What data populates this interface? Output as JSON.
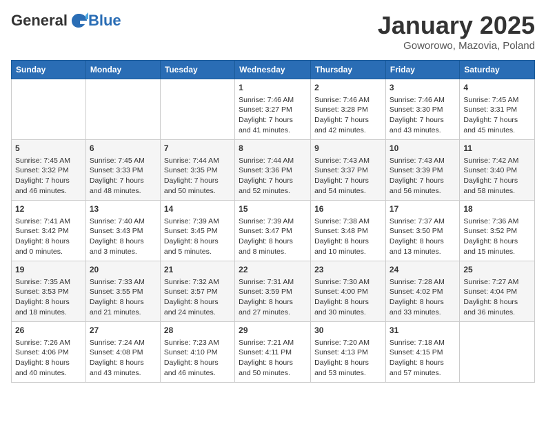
{
  "logo": {
    "general": "General",
    "blue": "Blue"
  },
  "title": "January 2025",
  "subtitle": "Goworowo, Mazovia, Poland",
  "days_of_week": [
    "Sunday",
    "Monday",
    "Tuesday",
    "Wednesday",
    "Thursday",
    "Friday",
    "Saturday"
  ],
  "weeks": [
    [
      {
        "day": "",
        "sunrise": "",
        "sunset": "",
        "daylight": ""
      },
      {
        "day": "",
        "sunrise": "",
        "sunset": "",
        "daylight": ""
      },
      {
        "day": "",
        "sunrise": "",
        "sunset": "",
        "daylight": ""
      },
      {
        "day": "1",
        "sunrise": "Sunrise: 7:46 AM",
        "sunset": "Sunset: 3:27 PM",
        "daylight": "Daylight: 7 hours and 41 minutes."
      },
      {
        "day": "2",
        "sunrise": "Sunrise: 7:46 AM",
        "sunset": "Sunset: 3:28 PM",
        "daylight": "Daylight: 7 hours and 42 minutes."
      },
      {
        "day": "3",
        "sunrise": "Sunrise: 7:46 AM",
        "sunset": "Sunset: 3:30 PM",
        "daylight": "Daylight: 7 hours and 43 minutes."
      },
      {
        "day": "4",
        "sunrise": "Sunrise: 7:45 AM",
        "sunset": "Sunset: 3:31 PM",
        "daylight": "Daylight: 7 hours and 45 minutes."
      }
    ],
    [
      {
        "day": "5",
        "sunrise": "Sunrise: 7:45 AM",
        "sunset": "Sunset: 3:32 PM",
        "daylight": "Daylight: 7 hours and 46 minutes."
      },
      {
        "day": "6",
        "sunrise": "Sunrise: 7:45 AM",
        "sunset": "Sunset: 3:33 PM",
        "daylight": "Daylight: 7 hours and 48 minutes."
      },
      {
        "day": "7",
        "sunrise": "Sunrise: 7:44 AM",
        "sunset": "Sunset: 3:35 PM",
        "daylight": "Daylight: 7 hours and 50 minutes."
      },
      {
        "day": "8",
        "sunrise": "Sunrise: 7:44 AM",
        "sunset": "Sunset: 3:36 PM",
        "daylight": "Daylight: 7 hours and 52 minutes."
      },
      {
        "day": "9",
        "sunrise": "Sunrise: 7:43 AM",
        "sunset": "Sunset: 3:37 PM",
        "daylight": "Daylight: 7 hours and 54 minutes."
      },
      {
        "day": "10",
        "sunrise": "Sunrise: 7:43 AM",
        "sunset": "Sunset: 3:39 PM",
        "daylight": "Daylight: 7 hours and 56 minutes."
      },
      {
        "day": "11",
        "sunrise": "Sunrise: 7:42 AM",
        "sunset": "Sunset: 3:40 PM",
        "daylight": "Daylight: 7 hours and 58 minutes."
      }
    ],
    [
      {
        "day": "12",
        "sunrise": "Sunrise: 7:41 AM",
        "sunset": "Sunset: 3:42 PM",
        "daylight": "Daylight: 8 hours and 0 minutes."
      },
      {
        "day": "13",
        "sunrise": "Sunrise: 7:40 AM",
        "sunset": "Sunset: 3:43 PM",
        "daylight": "Daylight: 8 hours and 3 minutes."
      },
      {
        "day": "14",
        "sunrise": "Sunrise: 7:39 AM",
        "sunset": "Sunset: 3:45 PM",
        "daylight": "Daylight: 8 hours and 5 minutes."
      },
      {
        "day": "15",
        "sunrise": "Sunrise: 7:39 AM",
        "sunset": "Sunset: 3:47 PM",
        "daylight": "Daylight: 8 hours and 8 minutes."
      },
      {
        "day": "16",
        "sunrise": "Sunrise: 7:38 AM",
        "sunset": "Sunset: 3:48 PM",
        "daylight": "Daylight: 8 hours and 10 minutes."
      },
      {
        "day": "17",
        "sunrise": "Sunrise: 7:37 AM",
        "sunset": "Sunset: 3:50 PM",
        "daylight": "Daylight: 8 hours and 13 minutes."
      },
      {
        "day": "18",
        "sunrise": "Sunrise: 7:36 AM",
        "sunset": "Sunset: 3:52 PM",
        "daylight": "Daylight: 8 hours and 15 minutes."
      }
    ],
    [
      {
        "day": "19",
        "sunrise": "Sunrise: 7:35 AM",
        "sunset": "Sunset: 3:53 PM",
        "daylight": "Daylight: 8 hours and 18 minutes."
      },
      {
        "day": "20",
        "sunrise": "Sunrise: 7:33 AM",
        "sunset": "Sunset: 3:55 PM",
        "daylight": "Daylight: 8 hours and 21 minutes."
      },
      {
        "day": "21",
        "sunrise": "Sunrise: 7:32 AM",
        "sunset": "Sunset: 3:57 PM",
        "daylight": "Daylight: 8 hours and 24 minutes."
      },
      {
        "day": "22",
        "sunrise": "Sunrise: 7:31 AM",
        "sunset": "Sunset: 3:59 PM",
        "daylight": "Daylight: 8 hours and 27 minutes."
      },
      {
        "day": "23",
        "sunrise": "Sunrise: 7:30 AM",
        "sunset": "Sunset: 4:00 PM",
        "daylight": "Daylight: 8 hours and 30 minutes."
      },
      {
        "day": "24",
        "sunrise": "Sunrise: 7:28 AM",
        "sunset": "Sunset: 4:02 PM",
        "daylight": "Daylight: 8 hours and 33 minutes."
      },
      {
        "day": "25",
        "sunrise": "Sunrise: 7:27 AM",
        "sunset": "Sunset: 4:04 PM",
        "daylight": "Daylight: 8 hours and 36 minutes."
      }
    ],
    [
      {
        "day": "26",
        "sunrise": "Sunrise: 7:26 AM",
        "sunset": "Sunset: 4:06 PM",
        "daylight": "Daylight: 8 hours and 40 minutes."
      },
      {
        "day": "27",
        "sunrise": "Sunrise: 7:24 AM",
        "sunset": "Sunset: 4:08 PM",
        "daylight": "Daylight: 8 hours and 43 minutes."
      },
      {
        "day": "28",
        "sunrise": "Sunrise: 7:23 AM",
        "sunset": "Sunset: 4:10 PM",
        "daylight": "Daylight: 8 hours and 46 minutes."
      },
      {
        "day": "29",
        "sunrise": "Sunrise: 7:21 AM",
        "sunset": "Sunset: 4:11 PM",
        "daylight": "Daylight: 8 hours and 50 minutes."
      },
      {
        "day": "30",
        "sunrise": "Sunrise: 7:20 AM",
        "sunset": "Sunset: 4:13 PM",
        "daylight": "Daylight: 8 hours and 53 minutes."
      },
      {
        "day": "31",
        "sunrise": "Sunrise: 7:18 AM",
        "sunset": "Sunset: 4:15 PM",
        "daylight": "Daylight: 8 hours and 57 minutes."
      },
      {
        "day": "",
        "sunrise": "",
        "sunset": "",
        "daylight": ""
      }
    ]
  ]
}
